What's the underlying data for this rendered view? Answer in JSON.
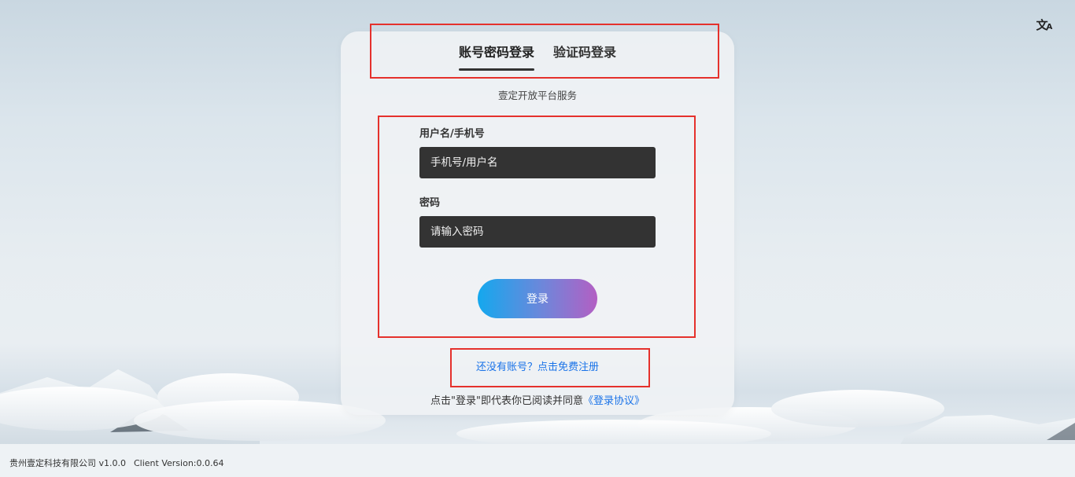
{
  "language_toggle": {
    "icon": "translate-icon",
    "glyph_main": "文",
    "glyph_sub": "A"
  },
  "tabs": [
    {
      "label": "账号密码登录",
      "active": true
    },
    {
      "label": "验证码登录",
      "active": false
    }
  ],
  "subtitle": "壹定开放平台服务",
  "form": {
    "username_label": "用户名/手机号",
    "username_placeholder": "手机号/用户名",
    "username_value": "",
    "password_label": "密码",
    "password_placeholder": "请输入密码",
    "password_value": "",
    "login_button_label": "登录"
  },
  "register_link": "还没有账号？点击免费注册",
  "agreement": {
    "text": "点击\"登录\"即代表你已阅读并同意",
    "link_label": "《登录协议》"
  },
  "footer": {
    "company": "贵州壹定科技有限公司 v1.0.0",
    "client_version": "Client Version:0.0.64"
  },
  "colors": {
    "highlight": "#e5312c",
    "link": "#1a73e8",
    "input_bg": "#333333",
    "button_gradient_start": "#14a8ee",
    "button_gradient_end": "#b35fc3"
  }
}
